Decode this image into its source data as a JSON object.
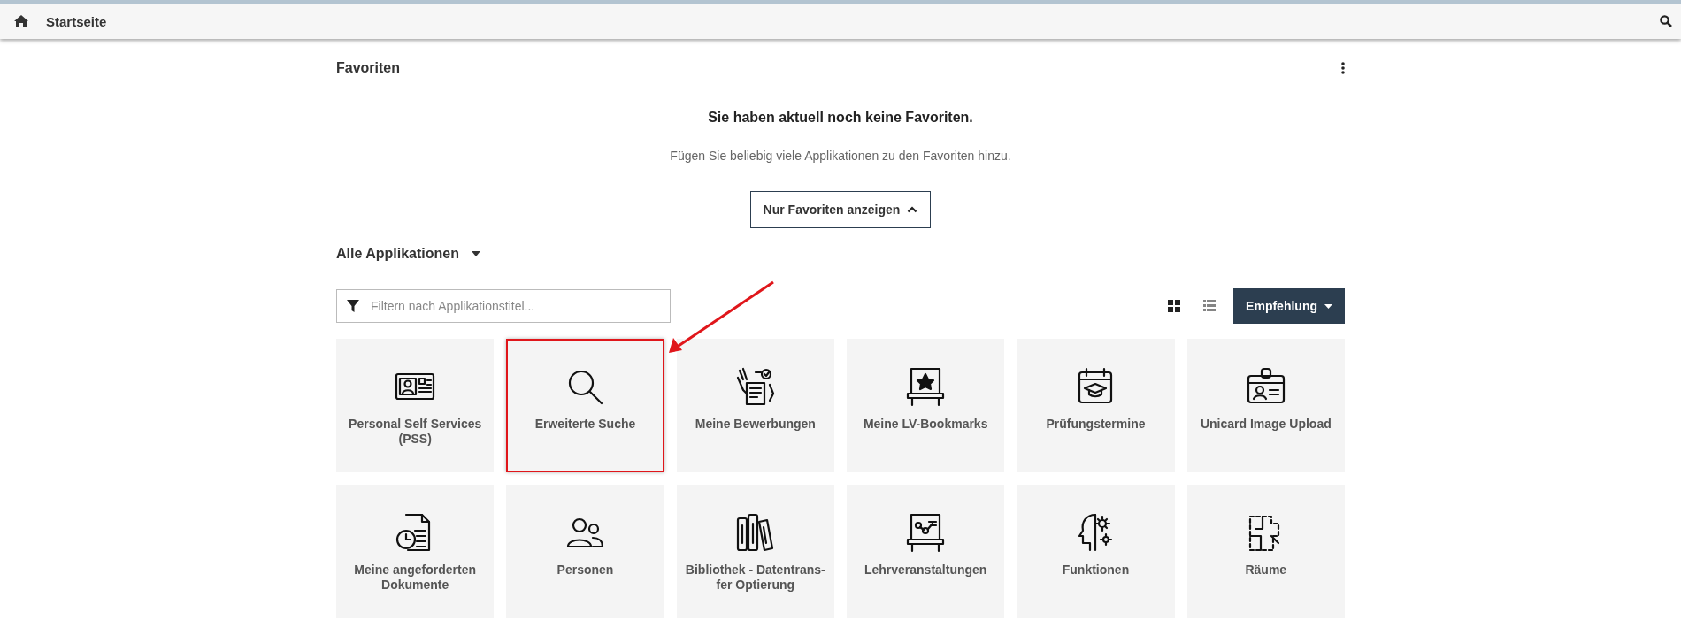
{
  "topbar": {
    "title": "Startseite"
  },
  "favorites": {
    "title": "Favoriten",
    "empty_title": "Sie haben aktuell noch keine Favoriten.",
    "empty_text": "Fügen Sie beliebig viele Applikationen zu den Favoriten hinzu.",
    "toggle": "Nur Favoriten anzeigen"
  },
  "apps": {
    "title": "Alle Applikationen",
    "filter": {
      "placeholder": "Filtern nach Applikationstitel..."
    },
    "views": [
      {
        "kind": "grid",
        "selected": true
      },
      {
        "kind": "list",
        "selected": false
      }
    ],
    "sort": "Empfehlung",
    "tiles": [
      {
        "label": "Personal Self Services (PSS)",
        "highlighted": false
      },
      {
        "label": "Erweiterte Suche",
        "highlighted": true
      },
      {
        "label": "Meine Bewerbungen",
        "highlighted": false
      },
      {
        "label": "Meine LV-Bookmarks",
        "highlighted": false
      },
      {
        "label": "Prüfungstermine",
        "highlighted": false
      },
      {
        "label": "Unicard Image Upload",
        "highlighted": false
      },
      {
        "label": "Meine angeforderten Dokumente",
        "highlighted": false
      },
      {
        "label": "Personen",
        "highlighted": false
      },
      {
        "label": "Bibliothek - Datentrans-fer Optierung",
        "highlighted": false
      },
      {
        "label": "Lehrveranstaltungen",
        "highlighted": false
      },
      {
        "label": "Funktionen",
        "highlighted": false
      },
      {
        "label": "Räume",
        "highlighted": false
      }
    ]
  }
}
